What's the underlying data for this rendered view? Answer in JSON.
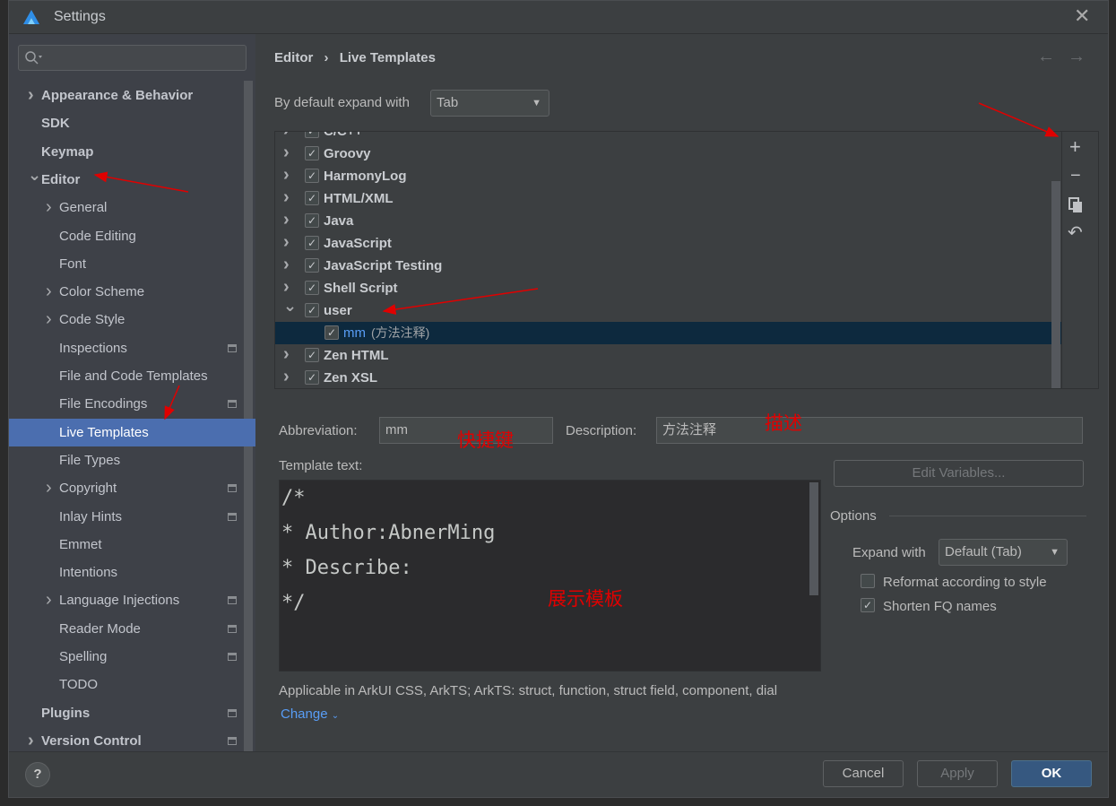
{
  "window": {
    "title": "Settings",
    "close_icon": "close-icon"
  },
  "search": {
    "placeholder": ""
  },
  "sidebar": {
    "items": [
      {
        "label": "Appearance & Behavior",
        "level": 0,
        "bold": true,
        "arrow": "right"
      },
      {
        "label": "SDK",
        "level": 0,
        "bold": true
      },
      {
        "label": "Keymap",
        "level": 0,
        "bold": true
      },
      {
        "label": "Editor",
        "level": 0,
        "bold": true,
        "arrow": "down"
      },
      {
        "label": "General",
        "level": 1,
        "arrow": "right"
      },
      {
        "label": "Code Editing",
        "level": 1
      },
      {
        "label": "Font",
        "level": 1
      },
      {
        "label": "Color Scheme",
        "level": 1,
        "arrow": "right"
      },
      {
        "label": "Code Style",
        "level": 1,
        "arrow": "right"
      },
      {
        "label": "Inspections",
        "level": 1,
        "page": true
      },
      {
        "label": "File and Code Templates",
        "level": 1
      },
      {
        "label": "File Encodings",
        "level": 1,
        "page": true
      },
      {
        "label": "Live Templates",
        "level": 1,
        "selected": true
      },
      {
        "label": "File Types",
        "level": 1
      },
      {
        "label": "Copyright",
        "level": 1,
        "arrow": "right",
        "page": true
      },
      {
        "label": "Inlay Hints",
        "level": 1,
        "page": true
      },
      {
        "label": "Emmet",
        "level": 1
      },
      {
        "label": "Intentions",
        "level": 1
      },
      {
        "label": "Language Injections",
        "level": 1,
        "arrow": "right",
        "page": true
      },
      {
        "label": "Reader Mode",
        "level": 1,
        "page": true
      },
      {
        "label": "Spelling",
        "level": 1,
        "page": true
      },
      {
        "label": "TODO",
        "level": 1
      },
      {
        "label": "Plugins",
        "level": 0,
        "bold": true,
        "page": true
      },
      {
        "label": "Version Control",
        "level": 0,
        "bold": true,
        "arrow": "right",
        "page": true
      }
    ]
  },
  "breadcrumb": {
    "parent": "Editor",
    "separator": "›",
    "current": "Live Templates"
  },
  "expand_default": {
    "label": "By default expand with",
    "value": "Tab"
  },
  "tree": {
    "rows": [
      {
        "label": "C/C++",
        "checked": true,
        "arrow": "right"
      },
      {
        "label": "Groovy",
        "checked": true,
        "arrow": "right"
      },
      {
        "label": "HarmonyLog",
        "checked": true,
        "arrow": "right"
      },
      {
        "label": "HTML/XML",
        "checked": true,
        "arrow": "right"
      },
      {
        "label": "Java",
        "checked": true,
        "arrow": "right"
      },
      {
        "label": "JavaScript",
        "checked": true,
        "arrow": "right"
      },
      {
        "label": "JavaScript Testing",
        "checked": true,
        "arrow": "right"
      },
      {
        "label": "Shell Script",
        "checked": true,
        "arrow": "right"
      },
      {
        "label": "user",
        "checked": true,
        "arrow": "down"
      },
      {
        "label": "mm",
        "desc": "(方法注释)",
        "checked": true,
        "child": true,
        "selected": true
      },
      {
        "label": "Zen HTML",
        "checked": true,
        "arrow": "right"
      },
      {
        "label": "Zen XSL",
        "checked": true,
        "arrow": "right"
      }
    ]
  },
  "toolbar": [
    "add-icon",
    "remove-icon",
    "copy-icon",
    "revert-icon"
  ],
  "form": {
    "abbreviation_label": "Abbreviation:",
    "abbreviation": "mm",
    "description_label": "Description:",
    "description": "方法注释",
    "template_label": "Template text:",
    "template_lines": [
      "/*",
      "* Author:AbnerMing",
      "* Describe:",
      "*/"
    ],
    "edit_variables": "Edit Variables...",
    "options_label": "Options",
    "expand_with_label": "Expand with",
    "expand_with": "Default (Tab)",
    "reformat_label": "Reformat according to style",
    "reformat": false,
    "shorten_label": "Shorten FQ names",
    "shorten": true,
    "applicable": "Applicable in ArkUI CSS, ArkTS; ArkTS: struct, function, struct field, component, dial",
    "change": "Change"
  },
  "footer": {
    "help": "?",
    "cancel": "Cancel",
    "apply": "Apply",
    "ok": "OK"
  },
  "annotations": {
    "shortcut": "快捷键",
    "describe": "描述",
    "template": "展示模板",
    "color": "#e00000"
  }
}
